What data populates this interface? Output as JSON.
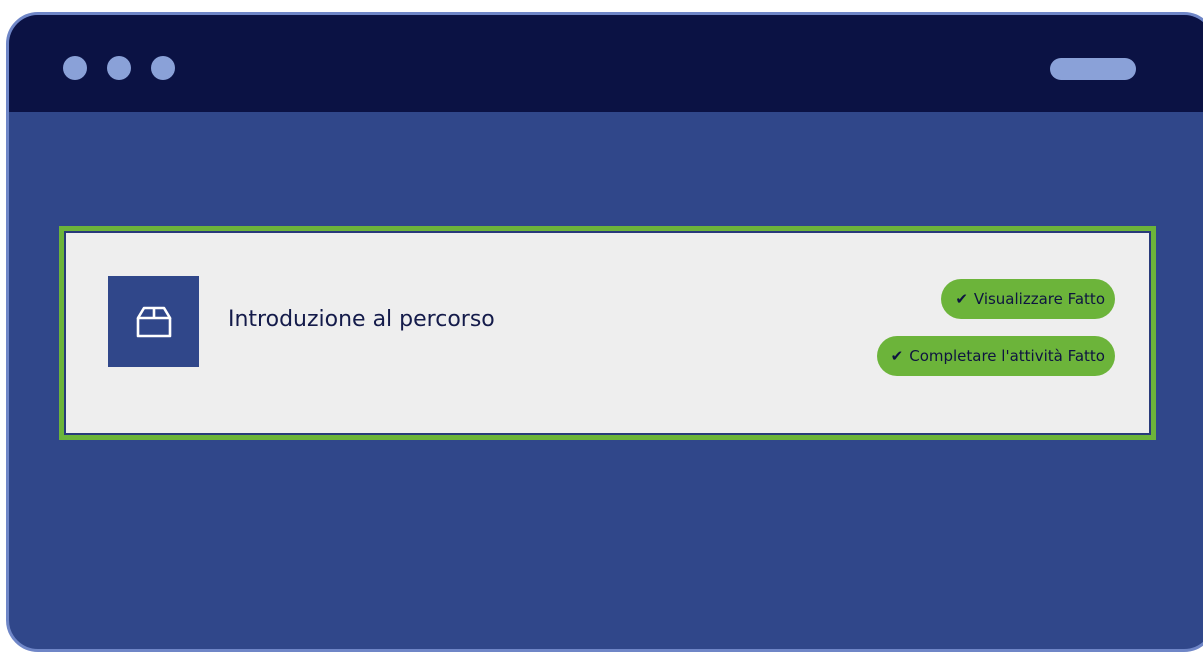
{
  "window": {
    "controls": {
      "dots": [
        "window-dot",
        "window-dot",
        "window-dot"
      ],
      "minimize_icon": "pill-icon"
    }
  },
  "activity": {
    "icon": "box-icon",
    "title": "Introduzione al percorso",
    "statuses": [
      {
        "check_icon": "✔",
        "label": "Visualizzare Fatto"
      },
      {
        "check_icon": "✔",
        "label": "Completare l'attività Fatto"
      }
    ]
  },
  "colors": {
    "window_bg": "#30478a",
    "titlebar_bg": "#0b1244",
    "accent_green": "#6cb43a",
    "card_bg": "#eeeeee"
  }
}
